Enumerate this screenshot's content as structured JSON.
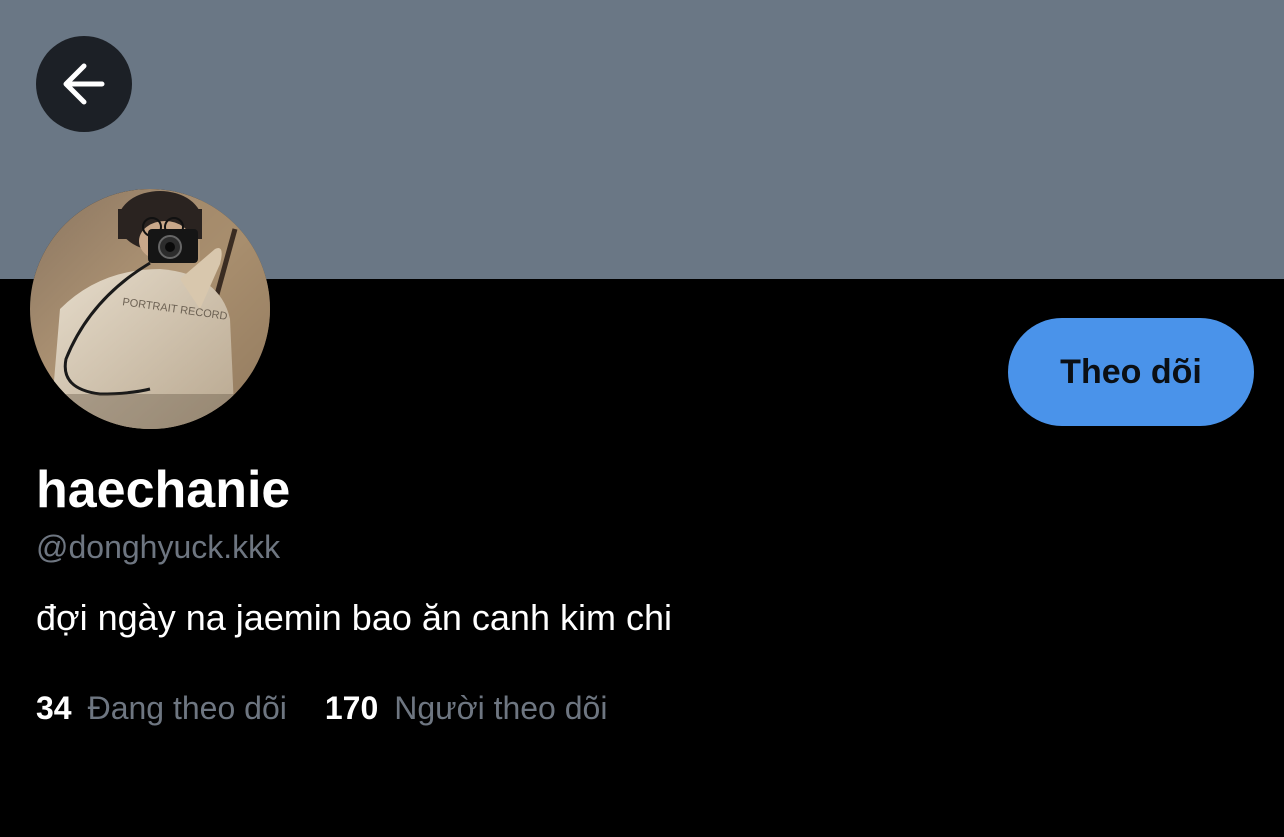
{
  "profile": {
    "display_name": "haechanie",
    "handle": "@donghyuck.kkk",
    "bio": "đợi ngày na jaemin bao ăn canh kim chi",
    "avatar_print_text": "PORTRAIT RECORD"
  },
  "actions": {
    "back_icon": "arrow-left-icon",
    "follow_label": "Theo dõi"
  },
  "stats": {
    "following_count": "34",
    "following_label": "Đang theo dõi",
    "followers_count": "170",
    "followers_label": "Người theo dõi"
  },
  "colors": {
    "banner": "#6a7785",
    "background": "#000000",
    "accent": "#4a93ea",
    "muted_text": "#6e7681"
  }
}
